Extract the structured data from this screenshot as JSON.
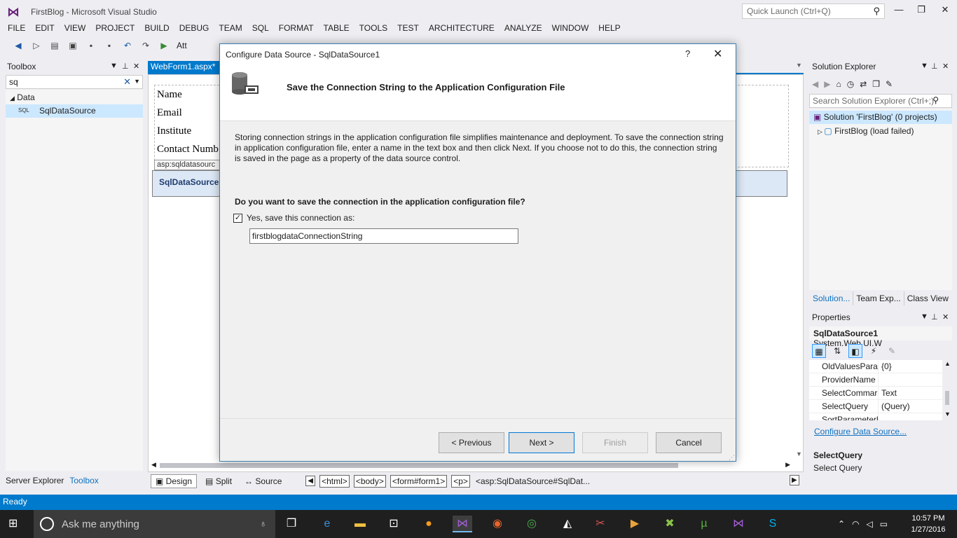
{
  "window": {
    "title": "FirstBlog - Microsoft Visual Studio",
    "quick_launch_placeholder": "Quick Launch (Ctrl+Q)"
  },
  "menu": [
    "FILE",
    "EDIT",
    "VIEW",
    "PROJECT",
    "BUILD",
    "DEBUG",
    "TEAM",
    "SQL",
    "FORMAT",
    "TABLE",
    "TOOLS",
    "TEST",
    "ARCHITECTURE",
    "ANALYZE",
    "WINDOW",
    "HELP"
  ],
  "toolbar": {
    "attach_label": "Att"
  },
  "toolbox": {
    "title": "Toolbox",
    "search_value": "sq",
    "group": "Data",
    "item_icon_text": "SQL",
    "item": "SqlDataSource",
    "bottom_tabs": [
      "Server Explorer",
      "Toolbox"
    ]
  },
  "document": {
    "tab": "WebForm1.aspx*",
    "labels": [
      "Name",
      "Email",
      "Institute",
      "Contact Numb"
    ],
    "asp_tag": "asp:sqldatasourc",
    "control_label": "SqlDataSource -",
    "views": [
      "Design",
      "Split",
      "Source"
    ],
    "breadcrumbs": [
      "<html>",
      "<body>",
      "<form#form1>",
      "<p>"
    ],
    "breadcrumb_last": "<asp:SqlDataSource#SqlDat..."
  },
  "solution_explorer": {
    "title": "Solution Explorer",
    "search_placeholder": "Search Solution Explorer (Ctrl+;)",
    "solution": "Solution 'FirstBlog' (0 projects)",
    "project": "FirstBlog (load failed)",
    "tabs": [
      "Solution...",
      "Team Exp...",
      "Class View"
    ]
  },
  "properties": {
    "title": "Properties",
    "object_name": "SqlDataSource1",
    "object_type": "System.Web.UI.W",
    "rows": [
      {
        "name": "OldValuesParar",
        "value": "{0}"
      },
      {
        "name": "ProviderName",
        "value": ""
      },
      {
        "name": "SelectCommar",
        "value": "Text"
      },
      {
        "name": "SelectQuery",
        "value": "(Query)"
      },
      {
        "name": "SortParameterl",
        "value": ""
      }
    ],
    "link": "Configure Data Source...",
    "desc_title": "SelectQuery",
    "desc_text": "Select Query"
  },
  "status": {
    "text": "Ready"
  },
  "taskbar": {
    "search_placeholder": "Ask me anything",
    "time": "10:57 PM",
    "date": "1/27/2016"
  },
  "dialog": {
    "title": "Configure Data Source - SqlDataSource1",
    "help": "?",
    "close": "✕",
    "heading": "Save the Connection String to the Application Configuration File",
    "description": "Storing connection strings in the application configuration file simplifies maintenance and deployment. To save the connection string in application configuration file, enter a name in the text box and then click Next. If you choose not to do this, the connection string is saved in the page as a property of the data source control.",
    "question": "Do you want to save the connection in the application configuration file?",
    "checkbox_label": "Yes, save this connection as:",
    "checkbox_checked": true,
    "connection_name": "firstblogdataConnectionString",
    "buttons": {
      "previous": "< Previous",
      "next": "Next >",
      "finish": "Finish",
      "cancel": "Cancel"
    }
  },
  "colors": {
    "accent": "#007acc",
    "selection": "#cce8ff",
    "vs_purple": "#68217a"
  }
}
